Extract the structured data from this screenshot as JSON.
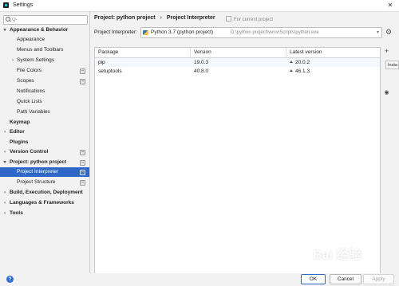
{
  "window": {
    "title": "Settings"
  },
  "search": {
    "placeholder": "Q-"
  },
  "sidebar": {
    "items": [
      {
        "label": "Appearance & Behavior",
        "arrow": "▾"
      },
      {
        "label": "Appearance"
      },
      {
        "label": "Menus and Toolbars"
      },
      {
        "label": "System Settings",
        "arrow": "›"
      },
      {
        "label": "File Colors"
      },
      {
        "label": "Scopes"
      },
      {
        "label": "Notifications"
      },
      {
        "label": "Quick Lists"
      },
      {
        "label": "Path Variables"
      },
      {
        "label": "Keymap"
      },
      {
        "label": "Editor",
        "arrow": "›"
      },
      {
        "label": "Plugins"
      },
      {
        "label": "Version Control",
        "arrow": "›"
      },
      {
        "label": "Project: python project",
        "arrow": "▾"
      },
      {
        "label": "Project Interpreter"
      },
      {
        "label": "Project Structure"
      },
      {
        "label": "Build, Execution, Deployment",
        "arrow": "›"
      },
      {
        "label": "Languages & Frameworks",
        "arrow": "›"
      },
      {
        "label": "Tools",
        "arrow": "›"
      }
    ]
  },
  "breadcrumb": {
    "project": "Project: python project",
    "separator": "›",
    "page": "Project Interpreter"
  },
  "scope_note": "For current project",
  "interpreter": {
    "label": "Project Interpreter:",
    "name": "Python 3.7 (python project)",
    "path": "D:\\python project\\venv\\Scripts\\python.exe"
  },
  "table": {
    "headers": [
      "Package",
      "Version",
      "Latest version"
    ],
    "rows": [
      {
        "package": "pip",
        "version": "19.0.3",
        "latest": "20.0.2"
      },
      {
        "package": "setuptools",
        "version": "40.8.0",
        "latest": "46.1.3"
      }
    ]
  },
  "tools": {
    "add": "+",
    "eye": "◉",
    "tooltip": "Insta"
  },
  "footer": {
    "help": "?",
    "ok": "OK",
    "cancel": "Cancel",
    "apply": "Apply"
  },
  "watermark": "Bai 经验"
}
